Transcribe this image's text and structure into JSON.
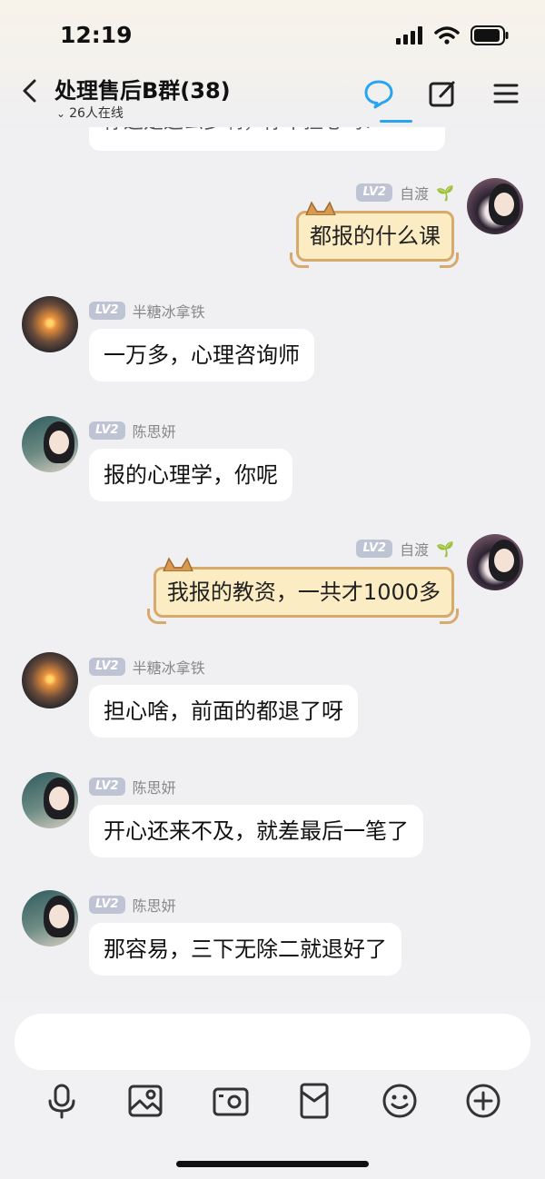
{
  "status_bar": {
    "time": "12:19"
  },
  "header": {
    "title": "处理售后B群(38)",
    "subtitle": "26人在线"
  },
  "chat": {
    "truncated_top": "你这是这么多啊，你不担心吗？",
    "messages": [
      {
        "side": "right",
        "level": "LV2",
        "sender": "自渡",
        "text": "都报的什么课",
        "style": "cat-bubble"
      },
      {
        "side": "left",
        "level": "LV2",
        "sender": "半糖冰拿铁",
        "text": "一万多，心理咨询师"
      },
      {
        "side": "left",
        "level": "LV2",
        "sender": "陈思妍",
        "text": "报的心理学，你呢"
      },
      {
        "side": "right",
        "level": "LV2",
        "sender": "自渡",
        "text": "我报的教资，一共才1000多",
        "style": "cat-bubble"
      },
      {
        "side": "left",
        "level": "LV2",
        "sender": "半糖冰拿铁",
        "text": "担心啥，前面的都退了呀"
      },
      {
        "side": "left",
        "level": "LV2",
        "sender": "陈思妍",
        "text": "开心还来不及，就差最后一笔了"
      },
      {
        "side": "left",
        "level": "LV2",
        "sender": "陈思妍",
        "text": "那容易，三下无除二就退好了"
      }
    ]
  },
  "colors": {
    "accent": "#28a4f0",
    "cat_bubble": "#fbecc3",
    "cat_border": "#d7a96a",
    "level_badge": "#bfc4d4"
  },
  "toolbar": {
    "icons": [
      "microphone-icon",
      "image-icon",
      "camera-icon",
      "red-packet-icon",
      "emoji-icon",
      "plus-icon"
    ]
  }
}
